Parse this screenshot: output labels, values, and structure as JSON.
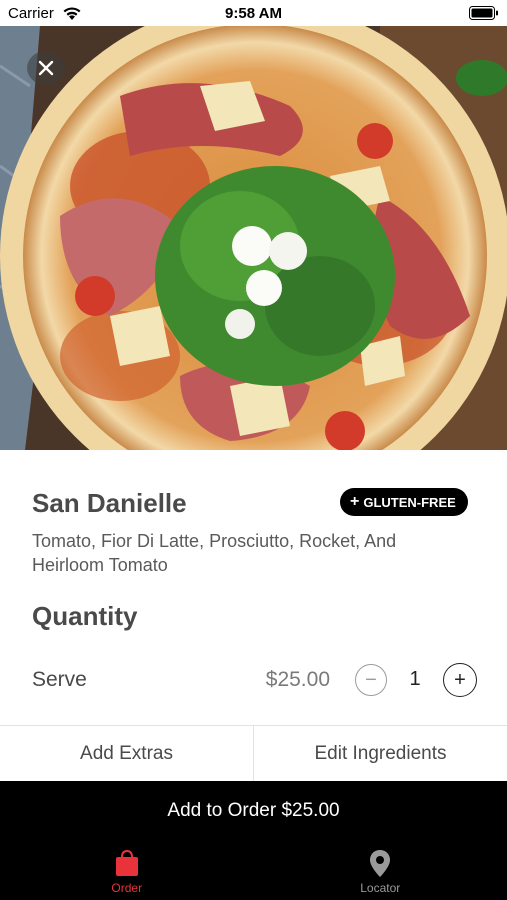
{
  "status_bar": {
    "carrier": "Carrier",
    "time": "9:58 AM"
  },
  "hero": {
    "image": "pizza-photo",
    "close_icon": "close-icon"
  },
  "product": {
    "name": "San Danielle",
    "badge": "GLUTEN-FREE",
    "badge_icon": "+",
    "description": "Tomato, Fior Di Latte, Prosciutto, Rocket, And Heirloom Tomato"
  },
  "quantity": {
    "heading": "Quantity",
    "serve_label": "Serve",
    "price": "$25.00",
    "minus": "−",
    "value": "1",
    "plus": "+"
  },
  "options": {
    "add_extras": "Add Extras",
    "edit_ingredients": "Edit Ingredients"
  },
  "cta": {
    "label": "Add to Order $25.00"
  },
  "tabs": [
    {
      "label": "Order",
      "icon": "shopping-bag-icon",
      "active": true,
      "color": "#e8333a"
    },
    {
      "label": "Locator",
      "icon": "map-pin-icon",
      "active": false,
      "color": "#9a9a9a"
    }
  ]
}
